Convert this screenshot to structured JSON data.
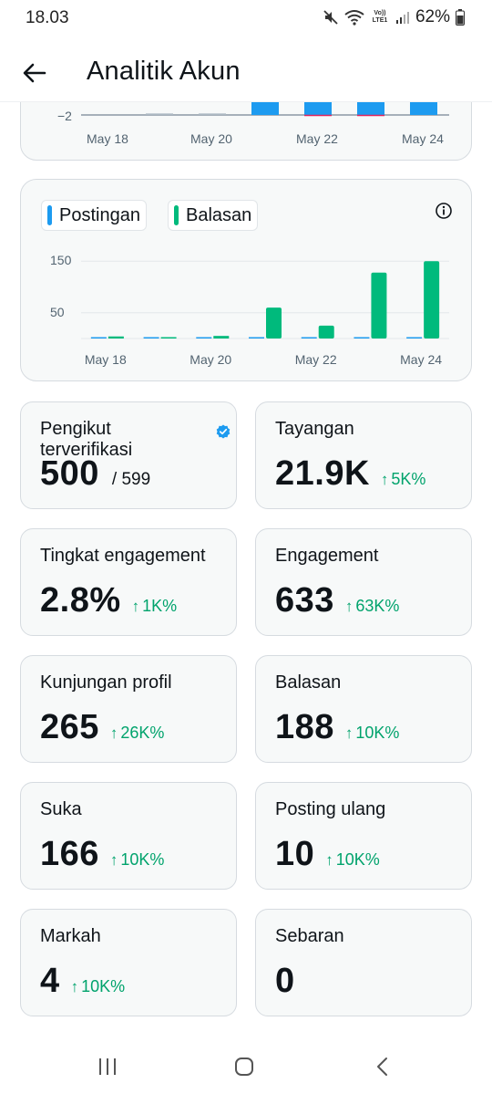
{
  "status_bar": {
    "time": "18.03",
    "battery": "62%",
    "network": "Vo)) LTE1"
  },
  "header": {
    "title": "Analitik Akun"
  },
  "top_chart": {
    "y_tick": "−2",
    "x_labels": [
      "May 18",
      "May 20",
      "May 22",
      "May 24"
    ]
  },
  "chart_data": {
    "type": "bar",
    "categories": [
      "May 18",
      "May 19",
      "May 20",
      "May 21",
      "May 22",
      "May 23",
      "May 24"
    ],
    "series": [
      {
        "name": "Postingan",
        "color": "#1d9bf0",
        "values": [
          0,
          0,
          0,
          1,
          1,
          1,
          2
        ]
      },
      {
        "name": "Balasan",
        "color": "#00ba7c",
        "values": [
          4,
          0,
          5,
          60,
          25,
          128,
          150
        ]
      }
    ],
    "y_ticks": [
      50,
      150
    ],
    "ylim": [
      0,
      170
    ],
    "x_labels": [
      "May 18",
      "May 20",
      "May 22",
      "May 24"
    ],
    "grid": true,
    "legend": "top-left"
  },
  "legend": {
    "postingan": "Postingan",
    "balasan": "Balasan"
  },
  "colors": {
    "accent_blue": "#1d9bf0",
    "accent_green": "#00ba7c",
    "positive": "#00a36c"
  },
  "stats": {
    "verified_followers": {
      "label": "Pengikut terverifikasi",
      "value": "500",
      "total": "/ 599"
    },
    "impressions": {
      "label": "Tayangan",
      "value": "21.9K",
      "change": "5K%"
    },
    "engagement_rate": {
      "label": "Tingkat engagement",
      "value": "2.8%",
      "change": "1K%"
    },
    "engagements": {
      "label": "Engagement",
      "value": "633",
      "change": "63K%"
    },
    "profile_visits": {
      "label": "Kunjungan profil",
      "value": "265",
      "change": "26K%"
    },
    "replies": {
      "label": "Balasan",
      "value": "188",
      "change": "10K%"
    },
    "likes": {
      "label": "Suka",
      "value": "166",
      "change": "10K%"
    },
    "reposts": {
      "label": "Posting ulang",
      "value": "10",
      "change": "10K%"
    },
    "bookmarks": {
      "label": "Markah",
      "value": "4",
      "change": "10K%"
    },
    "shares": {
      "label": "Sebaran",
      "value": "0"
    }
  },
  "icons": {
    "back": "arrow-left-icon",
    "info": "info-icon",
    "verified": "verified-badge-icon",
    "arrow_up": "↑"
  }
}
